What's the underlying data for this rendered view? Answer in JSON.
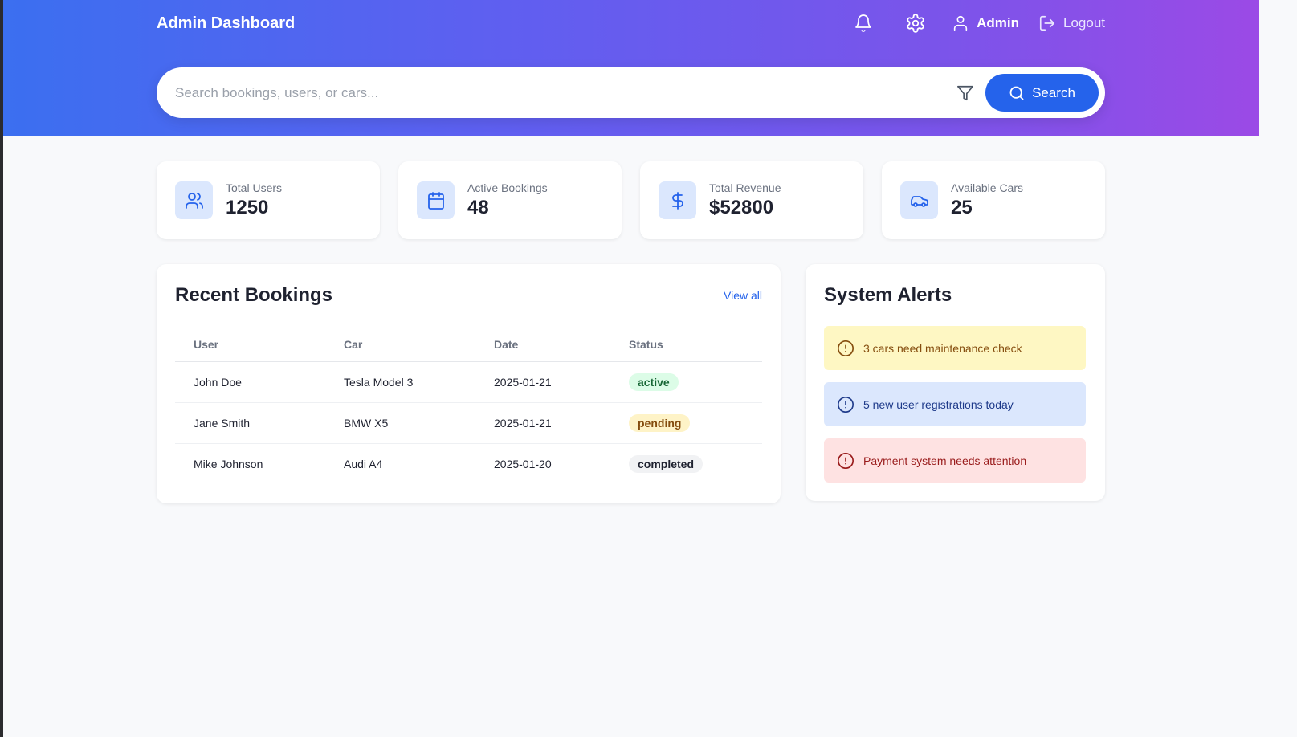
{
  "header": {
    "brand": "Admin Dashboard",
    "user_label": "Admin",
    "logout_label": "Logout"
  },
  "search": {
    "placeholder": "Search bookings, users, or cars...",
    "button_label": "Search"
  },
  "stats": [
    {
      "label": "Total Users",
      "value": "1250",
      "icon": "users-icon"
    },
    {
      "label": "Active Bookings",
      "value": "48",
      "icon": "calendar-icon"
    },
    {
      "label": "Total Revenue",
      "value": "$52800",
      "icon": "dollar-icon"
    },
    {
      "label": "Available Cars",
      "value": "25",
      "icon": "car-icon"
    }
  ],
  "bookings": {
    "title": "Recent Bookings",
    "view_all": "View all",
    "columns": [
      "User",
      "Car",
      "Date",
      "Status"
    ],
    "rows": [
      {
        "user": "John Doe",
        "car": "Tesla Model 3",
        "date": "2025-01-21",
        "status": "active"
      },
      {
        "user": "Jane Smith",
        "car": "BMW X5",
        "date": "2025-01-21",
        "status": "pending"
      },
      {
        "user": "Mike Johnson",
        "car": "Audi A4",
        "date": "2025-01-20",
        "status": "completed"
      }
    ]
  },
  "alerts": {
    "title": "System Alerts",
    "items": [
      {
        "text": "3 cars need maintenance check",
        "level": "warning"
      },
      {
        "text": "5 new user registrations today",
        "level": "info"
      },
      {
        "text": "Payment system needs attention",
        "level": "error"
      }
    ]
  },
  "colors": {
    "accent": "#2563eb",
    "header_gradient_start": "#3b6ff0",
    "header_gradient_end": "#9b4ae6"
  }
}
